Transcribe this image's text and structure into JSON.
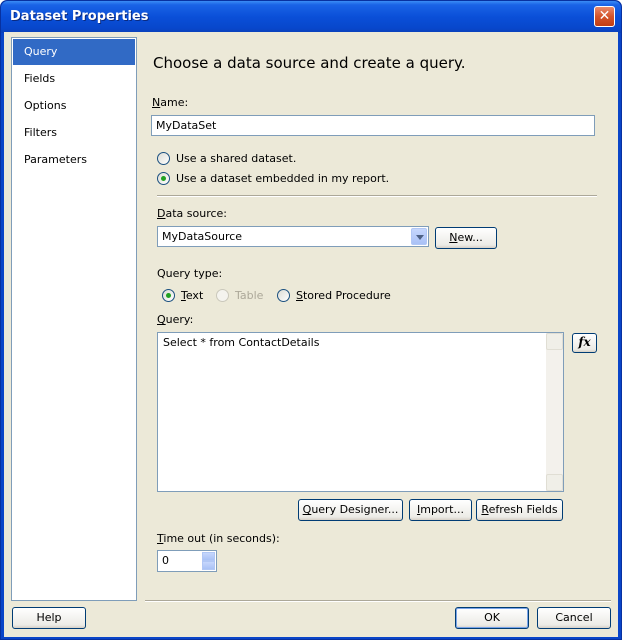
{
  "window": {
    "title": "Dataset Properties",
    "close_symbol": "✕"
  },
  "nav": {
    "items": [
      {
        "label": "Query"
      },
      {
        "label": "Fields"
      },
      {
        "label": "Options"
      },
      {
        "label": "Filters"
      },
      {
        "label": "Parameters"
      }
    ],
    "selected": "Query"
  },
  "main": {
    "heading": "Choose a data source and create a query.",
    "name_label_prefix": "",
    "name_label_ul": "N",
    "name_label_rest": "ame:",
    "name_value": "MyDataSet",
    "radio_shared": "Use a shared dataset.",
    "radio_embedded": "Use a dataset embedded in my report.",
    "datasource_label_ul": "D",
    "datasource_label_rest": "ata source:",
    "datasource_value": "MyDataSource",
    "new_btn_prefix": "",
    "new_btn_ul": "N",
    "new_btn_rest": "ew...",
    "query_type_label": "Query type:",
    "qt_text_ul": "T",
    "qt_text_rest": "ext",
    "qt_table": "Table",
    "qt_stored_ul": "S",
    "qt_stored_rest": "tored Procedure",
    "query_label_ul": "Q",
    "query_label_rest": "uery:",
    "query_text": "Select * from ContactDetails",
    "fx_label": "fx",
    "query_designer_ul": "Q",
    "query_designer_rest": "uery Designer...",
    "import_ul": "I",
    "import_rest": "mport...",
    "refresh_ul": "R",
    "refresh_rest": "efresh Fields",
    "timeout_label_ul": "T",
    "timeout_label_rest": "ime out (in seconds):",
    "timeout_value": "0"
  },
  "footer": {
    "help": "Help",
    "ok": "OK",
    "cancel": "Cancel"
  }
}
